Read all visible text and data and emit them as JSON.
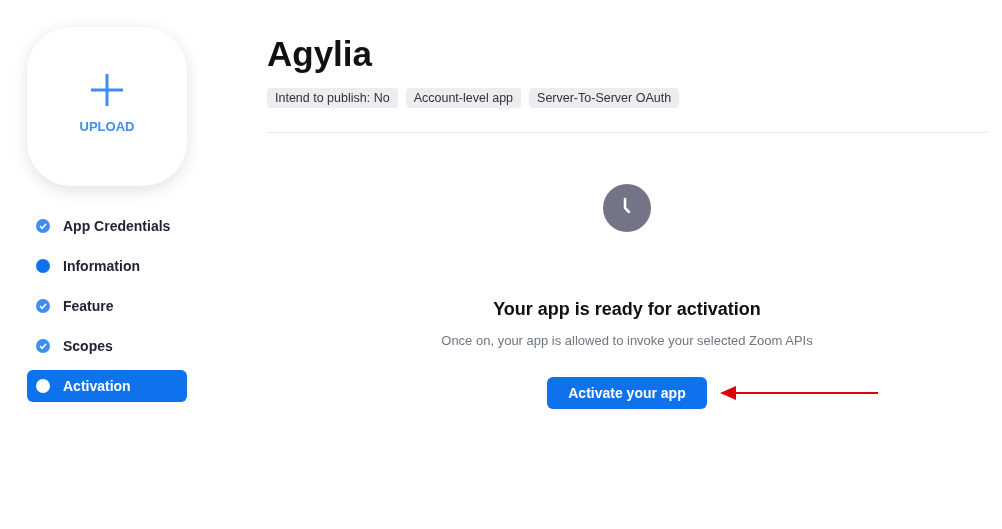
{
  "upload": {
    "label": "UPLOAD"
  },
  "steps": [
    {
      "label": "App Credentials",
      "completed": true,
      "selected": false
    },
    {
      "label": "Information",
      "completed": false,
      "selected": false
    },
    {
      "label": "Feature",
      "completed": true,
      "selected": false
    },
    {
      "label": "Scopes",
      "completed": true,
      "selected": false
    },
    {
      "label": "Activation",
      "completed": false,
      "selected": true
    }
  ],
  "app": {
    "title": "Agylia",
    "tags": [
      "Intend to publish: No",
      "Account-level app",
      "Server-To-Server OAuth"
    ]
  },
  "activation": {
    "heading": "Your app is ready for activation",
    "description": "Once on, your app is allowed to invoke your selected Zoom APIs",
    "button": "Activate your app"
  }
}
